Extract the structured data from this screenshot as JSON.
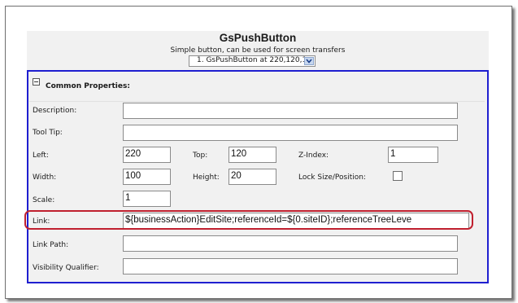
{
  "header": {
    "title": "GsPushButton",
    "subtitle": "Simple button, can be used for screen transfers",
    "instance_select": "1. GsPushButton at 220,120,1"
  },
  "group": {
    "label": "Common Properties:"
  },
  "fields": {
    "description": {
      "label": "Description:",
      "value": ""
    },
    "tooltip": {
      "label": "Tool Tip:",
      "value": ""
    },
    "left": {
      "label": "Left:",
      "value": "220"
    },
    "top": {
      "label": "Top:",
      "value": "120"
    },
    "zindex": {
      "label": "Z-Index:",
      "value": "1"
    },
    "width": {
      "label": "Width:",
      "value": "100"
    },
    "height": {
      "label": "Height:",
      "value": "20"
    },
    "lock": {
      "label": "Lock Size/Position:",
      "checked": false
    },
    "scale": {
      "label": "Scale:",
      "value": "1"
    },
    "link": {
      "label": "Link:",
      "value": "${businessAction}EditSite;referenceId=${0.siteID};referenceTreeLeve"
    },
    "link_path": {
      "label": "Link Path:",
      "value": ""
    },
    "visibility": {
      "label": "Visibility Qualifier:",
      "value": ""
    }
  },
  "colors": {
    "group_border": "#1f1fd0",
    "highlight": "#c0202f",
    "panel_bg": "#f1f1f1"
  },
  "icons": {
    "collapse": "minus-box-icon",
    "dropdown": "chevron-down-icon"
  }
}
